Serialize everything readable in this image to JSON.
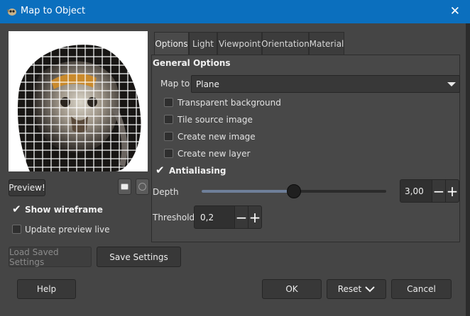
{
  "window": {
    "title": "Map to Object",
    "close_glyph": "✕",
    "app_icon": "gimp-icon"
  },
  "left": {
    "preview_button": "Preview!",
    "zoom_out_icon": "zoom-out-icon",
    "zoom_in_icon": "zoom-in-icon",
    "show_wireframe": {
      "label": "Show wireframe",
      "checked": true
    },
    "update_preview_live": {
      "label": "Update preview live",
      "checked": false
    },
    "load_saved_settings": "Load Saved Settings",
    "save_settings": "Save Settings"
  },
  "tabs": [
    "Options",
    "Light",
    "Viewpoint",
    "Orientation",
    "Material"
  ],
  "active_tab": "Options",
  "options": {
    "heading": "General Options",
    "map_to": {
      "label": "Map to",
      "value": "Plane"
    },
    "checkboxes": [
      {
        "label": "Transparent background",
        "checked": false
      },
      {
        "label": "Tile source image",
        "checked": false
      },
      {
        "label": "Create new image",
        "checked": false
      },
      {
        "label": "Create new layer",
        "checked": false
      }
    ],
    "antialiasing": {
      "label": "Antialiasing",
      "checked": true
    },
    "depth": {
      "label": "Depth",
      "value": "3,00",
      "slider_fraction": 0.5
    },
    "threshold": {
      "label": "Threshold",
      "value": "0,2"
    },
    "minus_glyph": "−",
    "plus_glyph": "+"
  },
  "footer": {
    "help": "Help",
    "ok": "OK",
    "reset": "Reset",
    "cancel": "Cancel"
  }
}
